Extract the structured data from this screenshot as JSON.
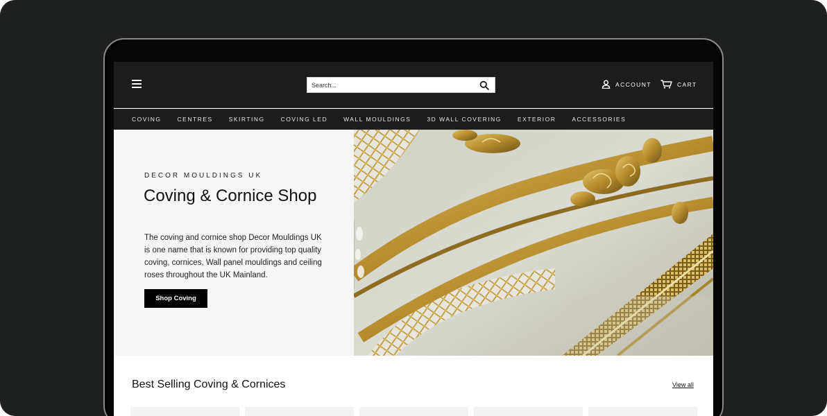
{
  "header": {
    "search_placeholder": "Search...",
    "account_label": "ACCOUNT",
    "cart_label": "CART"
  },
  "nav": {
    "items": [
      "COVING",
      "CENTRES",
      "SKIRTING",
      "COVING LED",
      "WALL MOULDINGS",
      "3D WALL COVERING",
      "EXTERIOR",
      "ACCESSORIES"
    ]
  },
  "hero": {
    "kicker": "DECOR MOULDINGS UK",
    "title": "Coving & Cornice Shop",
    "description": "The coving and cornice shop Decor Mouldings UK is one name that is known for providing top quality coving, cornices, Wall panel mouldings and ceiling roses throughout the UK Mainland.",
    "button_label": "Shop Coving"
  },
  "products": {
    "title": "Best Selling Coving & Cornices",
    "view_all": "View all"
  },
  "icons": {
    "menu": "menu-icon",
    "search": "search-icon",
    "account": "user-icon",
    "cart": "cart-icon"
  },
  "colors": {
    "header_bg": "#1c1c1c",
    "hero_bg": "#f6f6f6",
    "button_bg": "#000000",
    "gold": "#c8a13a"
  }
}
